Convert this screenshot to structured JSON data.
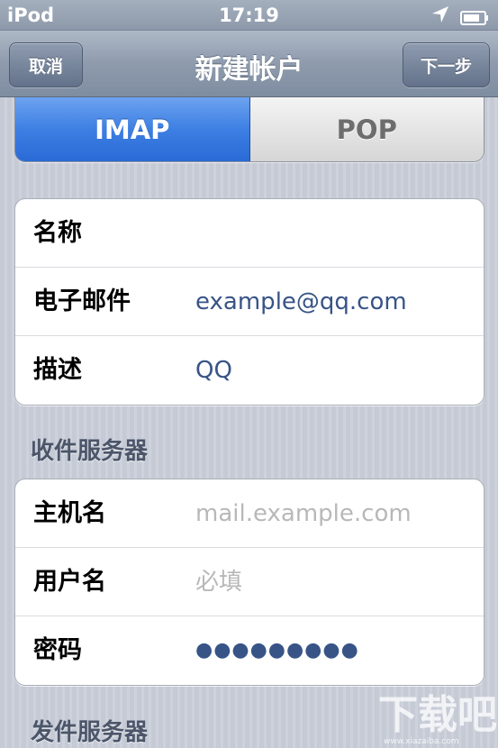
{
  "status_bar": {
    "carrier": "iPod",
    "time": "17:19",
    "location_icon": "location-arrow-icon",
    "battery_icon": "battery-icon"
  },
  "nav": {
    "title": "新建帐户",
    "cancel_label": "取消",
    "next_label": "下一步"
  },
  "segmented": {
    "options": [
      "IMAP",
      "POP"
    ],
    "selected": "IMAP"
  },
  "account": {
    "name_label": "名称",
    "name_value": "",
    "email_label": "电子邮件",
    "email_value": "example@qq.com",
    "description_label": "描述",
    "description_value": "QQ"
  },
  "incoming": {
    "header": "收件服务器",
    "host_label": "主机名",
    "host_placeholder": "mail.example.com",
    "username_label": "用户名",
    "username_placeholder": "必填",
    "password_label": "密码",
    "password_value": "●●●●●●●●●"
  },
  "outgoing": {
    "header": "发件服务器"
  },
  "watermark": {
    "text": "www.xiazaiba.com"
  },
  "colors": {
    "accent_blue": "#3d7fe3",
    "value_text": "#385487",
    "placeholder_text": "#b8b8b8"
  }
}
